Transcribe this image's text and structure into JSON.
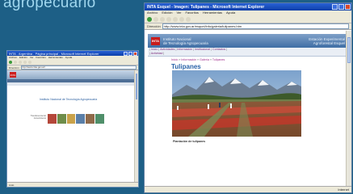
{
  "background_title": "agropecuario",
  "colors": {
    "background": "#1d5f86",
    "titlebar": "#0c3ea8",
    "inta_red": "#c81c1c"
  },
  "window_back": {
    "title": "INTA - Argentina - Página principal - Microsoft Internet Explorer",
    "menu": [
      "Archivo",
      "Edición",
      "Ver",
      "Favoritos",
      "Herramientas",
      "Ayuda"
    ],
    "address_label": "Dirección",
    "address": "http://www.inta.gov.ar/",
    "logo": "INTA",
    "heading": "Instituto Nacional de Tecnología Agropecuaria",
    "caption": "Transferencia del Conocimiento",
    "status": "Listo"
  },
  "window_front": {
    "title": "INTA Esquel - Imagen: Tulipanes - Microsoft Internet Explorer",
    "menu": [
      "Archivo",
      "Edición",
      "Ver",
      "Favoritos",
      "Herramientas",
      "Ayuda"
    ],
    "address_label": "Dirección",
    "address": "http://www.inta.gov.ar/esquel/info/galeria/tulipanes.htm",
    "logo": "INTA",
    "org_line1": "Instituto Nacional",
    "org_line2": "de Tecnología Agropecuaria",
    "station_line1": "Estación Experimental",
    "station_line2": "Agroforestal Esquel",
    "nav": [
      "Inicio",
      "Actividades",
      "Información",
      "Institucional",
      "Contactos",
      "Actividad"
    ],
    "breadcrumb": [
      "Inicio",
      "Información",
      "Galería",
      "Tulipanes"
    ],
    "page_title": "Tulipanes",
    "photo_caption": "Plantación de tulipanes",
    "status": "Internet"
  }
}
